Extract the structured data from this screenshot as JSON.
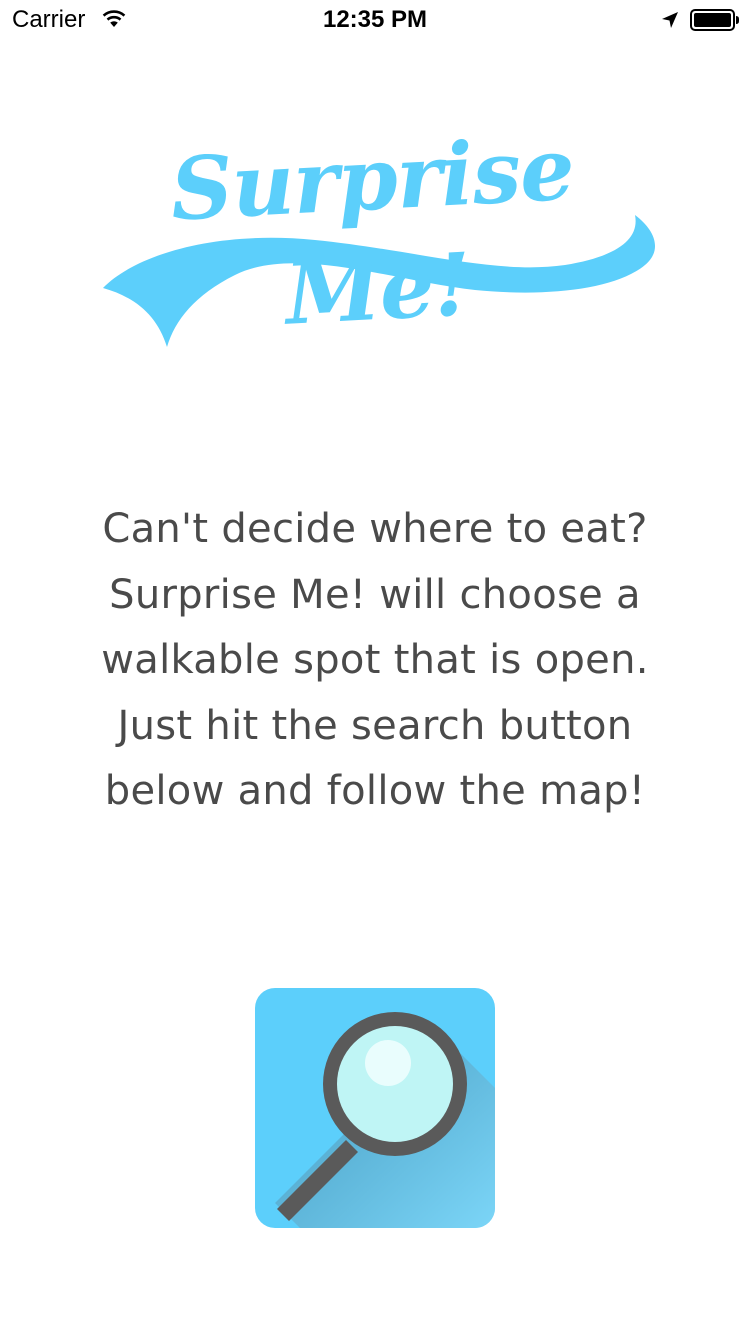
{
  "status_bar": {
    "carrier": "Carrier",
    "time": "12:35 PM",
    "icons": [
      "wifi-icon",
      "location-arrow-icon",
      "battery-icon"
    ]
  },
  "logo": {
    "text": "Surprise Me!",
    "color": "#5ccffb"
  },
  "description": {
    "lines": [
      "Can't decide where to eat?",
      "Surprise Me! will choose a",
      "walkable spot that is open.",
      "Just hit the search button",
      "below and follow the map!"
    ],
    "color": "#4a4a4a"
  },
  "search_button": {
    "icon": "magnifying-glass-icon",
    "background": "#5ccffb",
    "lens_color": "#bff5f5",
    "frame_color": "#5a5a5a"
  }
}
